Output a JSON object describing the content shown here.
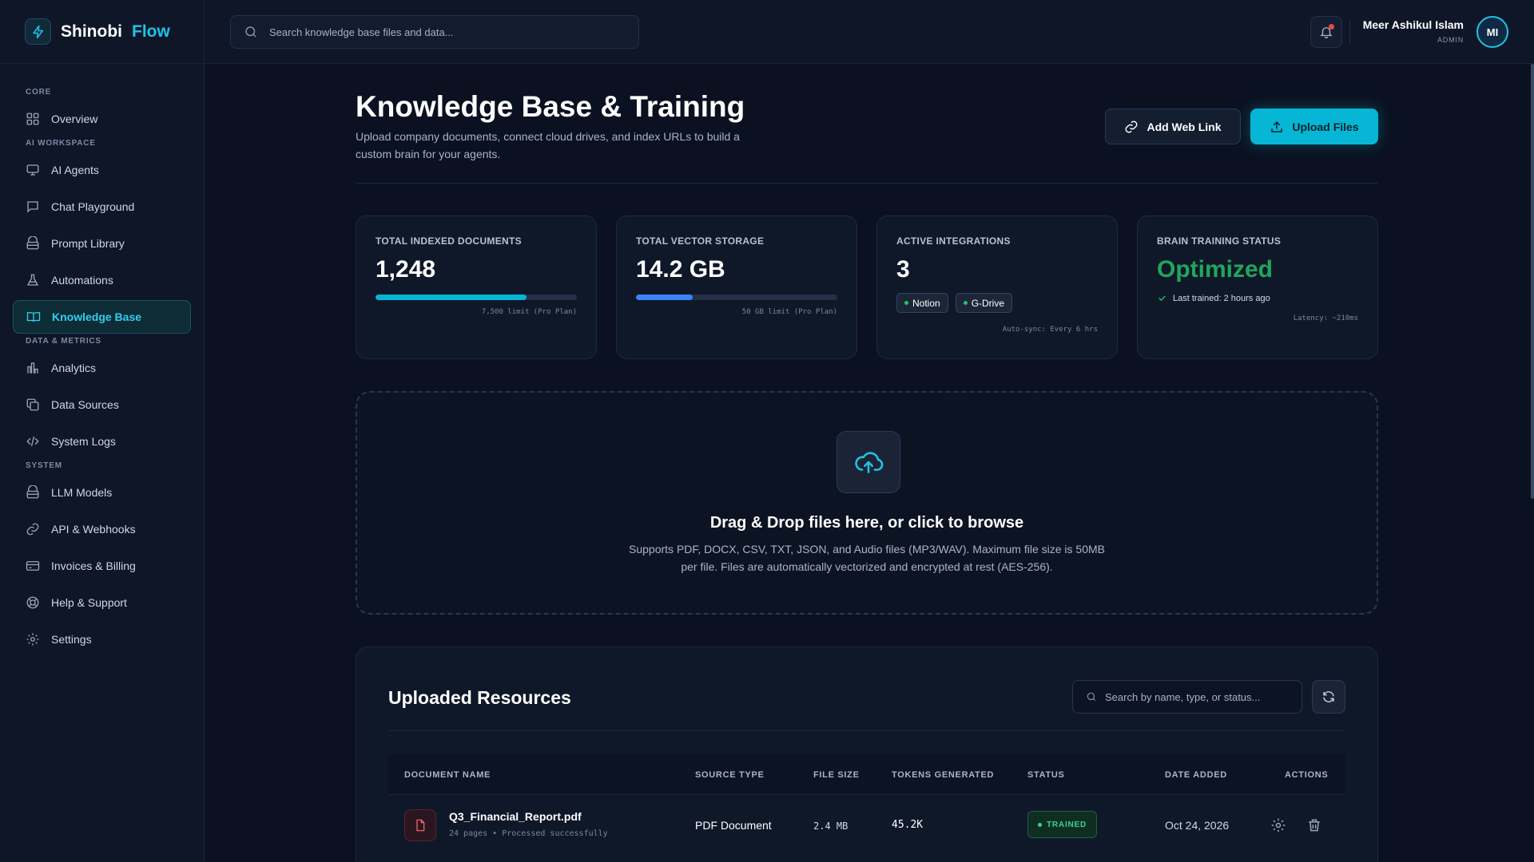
{
  "brand": {
    "name": "Shinobi",
    "accent": "Flow",
    "accent_color": "#22c3e6"
  },
  "sidebar": {
    "sections": [
      {
        "label": "CORE",
        "items": [
          {
            "label": "Overview",
            "icon": "grid-icon"
          }
        ]
      },
      {
        "label": "AI WORKSPACE",
        "items": [
          {
            "label": "AI Agents",
            "icon": "monitor-icon"
          },
          {
            "label": "Chat Playground",
            "icon": "chat-icon"
          },
          {
            "label": "Prompt Library",
            "icon": "library-icon"
          },
          {
            "label": "Automations",
            "icon": "flask-icon"
          },
          {
            "label": "Knowledge Base",
            "icon": "book-icon",
            "active": true
          }
        ]
      },
      {
        "label": "DATA & METRICS",
        "items": [
          {
            "label": "Analytics",
            "icon": "bar-chart-icon"
          },
          {
            "label": "Data Sources",
            "icon": "copy-icon"
          },
          {
            "label": "System Logs",
            "icon": "code-icon"
          }
        ]
      },
      {
        "label": "SYSTEM",
        "items": [
          {
            "label": "LLM Models",
            "icon": "library-icon"
          },
          {
            "label": "API & Webhooks",
            "icon": "link-icon"
          },
          {
            "label": "Invoices & Billing",
            "icon": "card-icon"
          },
          {
            "label": "Help & Support",
            "icon": "lifebuoy-icon"
          },
          {
            "label": "Settings",
            "icon": "gear-icon"
          }
        ]
      }
    ]
  },
  "header": {
    "search_placeholder": "Search knowledge base files and data...",
    "user_name": "Meer Ashikul Islam",
    "user_role": "ADMIN",
    "avatar_initials": "MI"
  },
  "page": {
    "title": "Knowledge Base & Training",
    "subtitle": "Upload company documents, connect cloud drives, and index URLs to build a custom brain for your agents.",
    "add_link_label": "Add Web Link",
    "upload_label": "Upload Files"
  },
  "stats": {
    "docs": {
      "label": "TOTAL INDEXED DOCUMENTS",
      "value": "1,248",
      "note": "7,500 limit (Pro Plan)",
      "fill_fraction": 0.75,
      "fill_color": "#06b6d4"
    },
    "storage": {
      "label": "TOTAL VECTOR STORAGE",
      "value": "14.2 GB",
      "note": "50 GB limit (Pro Plan)",
      "fill_fraction": 0.28,
      "fill_color": "#3b82f6"
    },
    "integrations": {
      "label": "ACTIVE INTEGRATIONS",
      "value": "3",
      "chips": [
        "Notion",
        "G-Drive"
      ],
      "note": "Auto-sync: Every 6 hrs"
    },
    "training": {
      "label": "BRAIN TRAINING STATUS",
      "value": "Optimized",
      "value_color": "#22a55a",
      "last_trained": "Last trained: 2 hours ago",
      "note": "Latency: ~210ms"
    }
  },
  "dropzone": {
    "title": "Drag & Drop files here, or click to browse",
    "description": "Supports PDF, DOCX, CSV, TXT, JSON, and Audio files (MP3/WAV). Maximum file size is 50MB per file. Files are automatically vectorized and encrypted at rest (AES-256)."
  },
  "resources": {
    "title": "Uploaded Resources",
    "search_placeholder": "Search by name, type, or status...",
    "columns": [
      "DOCUMENT NAME",
      "SOURCE TYPE",
      "FILE SIZE",
      "TOKENS GENERATED",
      "STATUS",
      "DATE ADDED",
      "ACTIONS"
    ],
    "rows": [
      {
        "name": "Q3_Financial_Report.pdf",
        "meta": "24 pages • Processed successfully",
        "source": "PDF Document",
        "size": "2.4 MB",
        "tokens": "45.2K",
        "status": "TRAINED",
        "date": "Oct 24, 2026"
      }
    ]
  }
}
